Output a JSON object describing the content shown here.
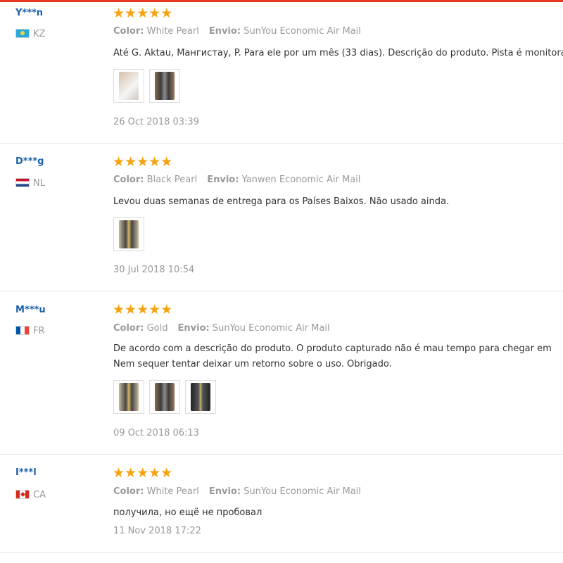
{
  "reviews": [
    {
      "user": "Y***n",
      "country": "KZ",
      "stars": "★★★★★",
      "color_label": "Color:",
      "color_value": "White Pearl",
      "envio_label": "Envio:",
      "envio_value": "SunYou Economic Air Mail",
      "lines": [
        "Até G. Aktau, Мангистау, P. Para ele por um mês (33 dias). Descrição do produto. Pista é monitorada."
      ],
      "date": "26 Oct 2018 03:39"
    },
    {
      "user": "D***g",
      "country": "NL",
      "stars": "★★★★★",
      "color_label": "Color:",
      "color_value": "Black Pearl",
      "envio_label": "Envio:",
      "envio_value": "Yanwen Economic Air Mail",
      "lines": [
        "Levou duas semanas de entrega para os Países Baixos. Não usado ainda."
      ],
      "date": "30 Jul 2018 10:54"
    },
    {
      "user": "M***u",
      "country": "FR",
      "stars": "★★★★★",
      "color_label": "Color:",
      "color_value": "Gold",
      "envio_label": "Envio:",
      "envio_value": "SunYou Economic Air Mail",
      "lines": [
        "De acordo com a descrição do produto. O produto capturado não é mau tempo para chegar em",
        "Nem sequer tentar deixar um retorno sobre o uso. Obrigado."
      ],
      "date": "09 Oct 2018 06:13"
    },
    {
      "user": "I***l",
      "country": "CA",
      "stars": "★★★★★",
      "color_label": "Color:",
      "color_value": "White Pearl",
      "envio_label": "Envio:",
      "envio_value": "SunYou Economic Air Mail",
      "lines": [
        "получила, но ещё не пробовал"
      ],
      "date": "11 Nov 2018 17:22"
    }
  ],
  "colors": {
    "accent": "#e8391e",
    "star": "#f6a210",
    "username": "#1a5fa8",
    "meta": "#999999"
  }
}
